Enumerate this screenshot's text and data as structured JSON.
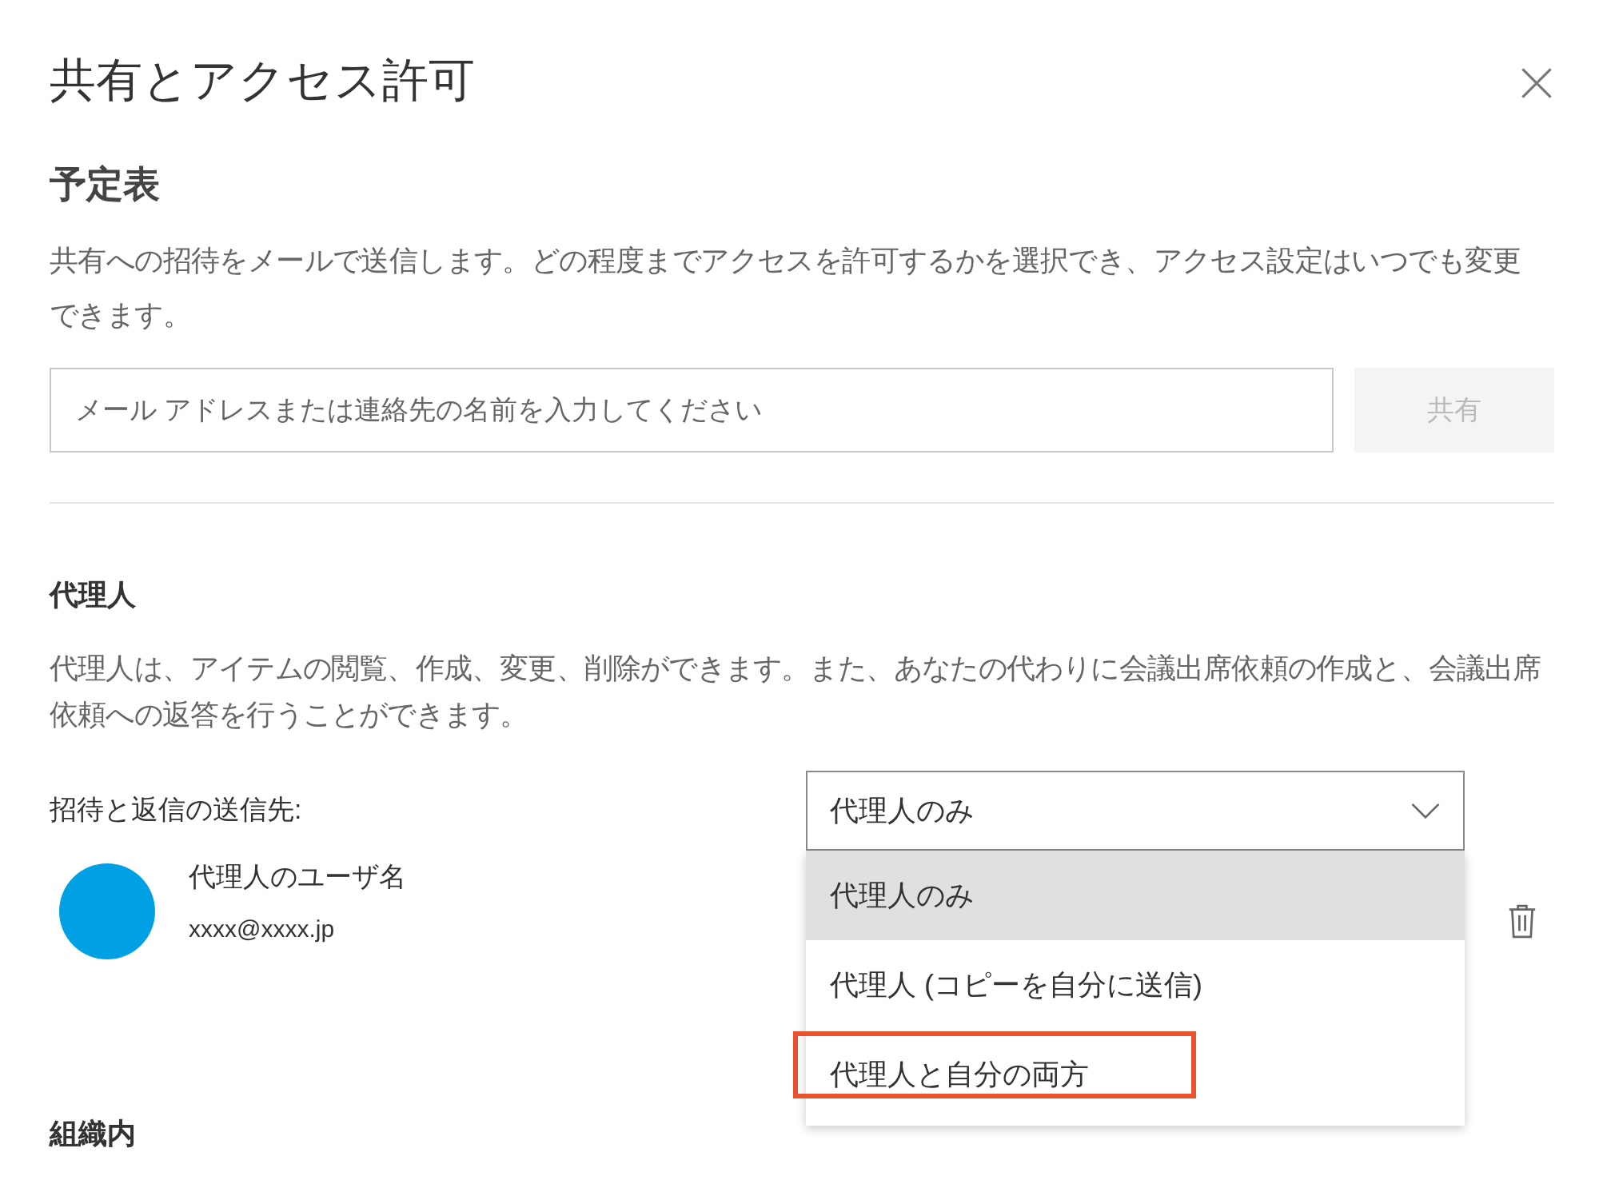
{
  "dialog": {
    "title": "共有とアクセス許可"
  },
  "calendar_section": {
    "heading": "予定表",
    "description": "共有への招待をメールで送信します。どの程度までアクセスを許可するかを選択でき、アクセス設定はいつでも変更できます。",
    "email_field": {
      "placeholder": "メール アドレスまたは連絡先の名前を入力してください"
    },
    "share_button": {
      "label": "共有",
      "disabled": true
    }
  },
  "delegate_section": {
    "heading": "代理人",
    "description": "代理人は、アイテムの閲覧、作成、変更、削除ができます。また、あなたの代わりに会議出席依頼の作成と、会議出席依頼への返答を行うことができます。",
    "send_to_label": "招待と返信の送信先:",
    "send_to_select": {
      "value": "代理人のみ",
      "expanded": true,
      "options": [
        {
          "label": "代理人のみ",
          "selected": true,
          "annotated": false
        },
        {
          "label": "代理人 (コピーを自分に送信)",
          "selected": false,
          "annotated": false
        },
        {
          "label": "代理人と自分の両方",
          "selected": false,
          "annotated": true
        }
      ]
    },
    "delegate": {
      "name": "代理人のユーザ名",
      "email": "xxxx@xxxx.jp",
      "color": "#00a1e4"
    }
  },
  "org_section": {
    "heading": "組織内"
  }
}
